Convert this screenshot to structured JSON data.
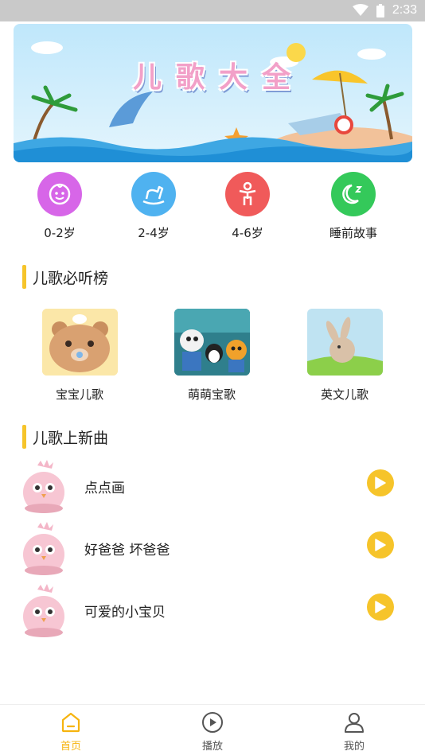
{
  "status_bar": {
    "time": "2:33",
    "icons": [
      "wifi-icon",
      "battery-icon"
    ]
  },
  "banner": {
    "title": "儿歌大全"
  },
  "categories": [
    {
      "label": "0-2岁",
      "icon": "baby-face-icon",
      "color": "#d766e8"
    },
    {
      "label": "2-4岁",
      "icon": "rocking-horse-icon",
      "color": "#4fb2f0"
    },
    {
      "label": "4-6岁",
      "icon": "child-icon",
      "color": "#f05a5a"
    },
    {
      "label": "睡前故事",
      "icon": "moon-sleep-icon",
      "color": "#34c95a"
    }
  ],
  "sections": {
    "top_list": {
      "title": "儿歌必听榜"
    },
    "new_songs": {
      "title": "儿歌上新曲"
    }
  },
  "albums": [
    {
      "label": "宝宝儿歌",
      "image": "bear-image"
    },
    {
      "label": "萌萌宝歌",
      "image": "octonauts-image"
    },
    {
      "label": "英文儿歌",
      "image": "bunny-image"
    }
  ],
  "songs": [
    {
      "title": "点点画"
    },
    {
      "title": "好爸爸 坏爸爸"
    },
    {
      "title": "可爱的小宝贝"
    }
  ],
  "tabbar": {
    "accent": "#f6b40f",
    "tabs": [
      {
        "label": "首页",
        "icon": "home-icon",
        "active": true
      },
      {
        "label": "播放",
        "icon": "play-circle-icon",
        "active": false
      },
      {
        "label": "我的",
        "icon": "user-icon",
        "active": false
      }
    ]
  }
}
